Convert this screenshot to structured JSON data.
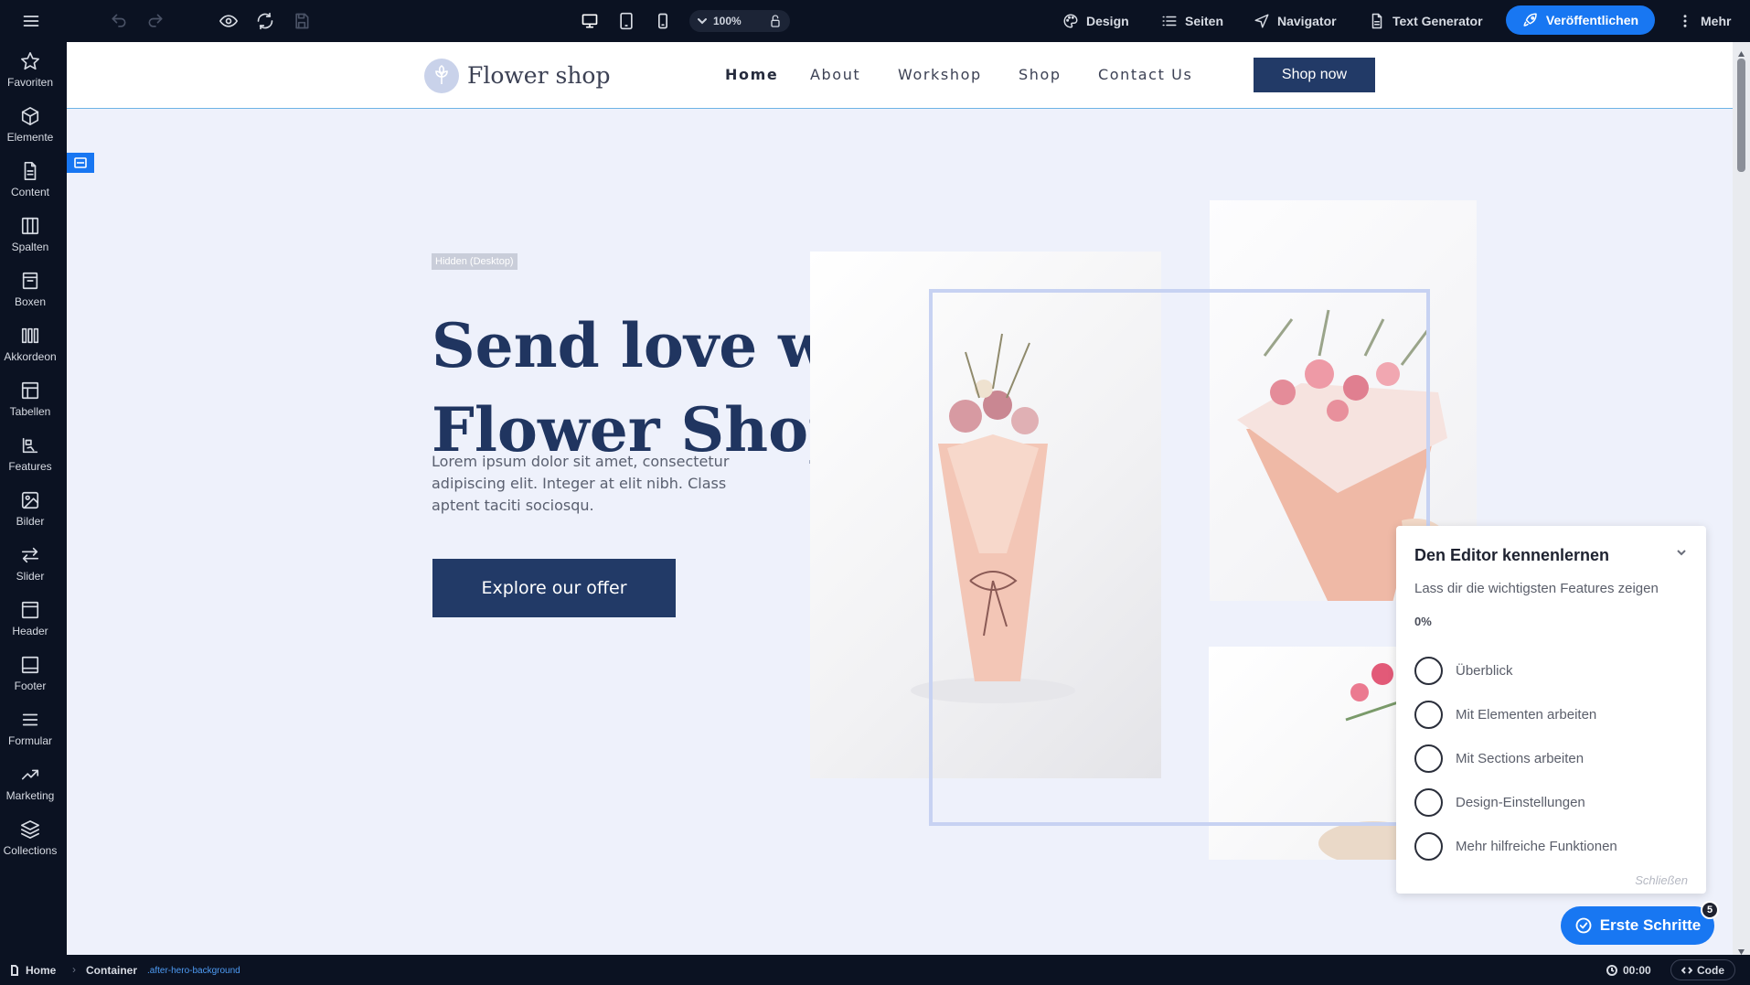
{
  "topbar": {
    "zoom_value": "100%",
    "links": {
      "design": "Design",
      "pages": "Seiten",
      "navigator": "Navigator",
      "text_generator": "Text Generator"
    },
    "publish_label": "Veröffentlichen",
    "more_label": "Mehr"
  },
  "sidebar": {
    "items": [
      {
        "label": "Favoriten",
        "icon": "star-icon"
      },
      {
        "label": "Elemente",
        "icon": "cube-icon"
      },
      {
        "label": "Content",
        "icon": "document-icon"
      },
      {
        "label": "Spalten",
        "icon": "columns-icon"
      },
      {
        "label": "Boxen",
        "icon": "box-icon"
      },
      {
        "label": "Akkordeon",
        "icon": "accordion-icon"
      },
      {
        "label": "Tabellen",
        "icon": "table-icon"
      },
      {
        "label": "Features",
        "icon": "features-icon"
      },
      {
        "label": "Bilder",
        "icon": "image-icon"
      },
      {
        "label": "Slider",
        "icon": "slider-icon"
      },
      {
        "label": "Header",
        "icon": "header-icon"
      },
      {
        "label": "Footer",
        "icon": "footer-icon"
      },
      {
        "label": "Formular",
        "icon": "form-icon"
      },
      {
        "label": "Marketing",
        "icon": "trending-icon"
      },
      {
        "label": "Collections",
        "icon": "layers-icon"
      }
    ]
  },
  "site": {
    "logo_text": "Flower shop",
    "nav": [
      "Home",
      "About",
      "Workshop",
      "Shop",
      "Contact Us"
    ],
    "nav_cta": "Shop now",
    "hidden_badge": "Hidden (Desktop)",
    "hero_title_line1": "Send love with",
    "hero_title_line2": "Flower Shop",
    "hero_text": "Lorem ipsum dolor sit amet, consectetur adipiscing elit. Integer at elit nibh. Class aptent taciti sociosqu.",
    "hero_button": "Explore our offer"
  },
  "onboarding": {
    "title": "Den Editor kennenlernen",
    "subtitle": "Lass dir die wichtigsten Features zeigen",
    "progress": "0%",
    "progress_value": 0,
    "steps": [
      "Überblick",
      "Mit Elementen arbeiten",
      "Mit Sections arbeiten",
      "Design-Einstellungen",
      "Mehr hilfreiche Funktionen"
    ],
    "close_label": "Schließen",
    "first_steps_label": "Erste Schritte",
    "first_steps_count": "5"
  },
  "bottombar": {
    "breadcrumb_home": "Home",
    "breadcrumb_container": "Container",
    "breadcrumb_class": ".after-hero-background",
    "time": "00:00",
    "code_label": "Code"
  },
  "colors": {
    "editor_bg": "#0b1222",
    "accent": "#1877f2",
    "brand_navy": "#223a67",
    "hero_bg": "#eef1fb",
    "title_color": "#203560"
  }
}
